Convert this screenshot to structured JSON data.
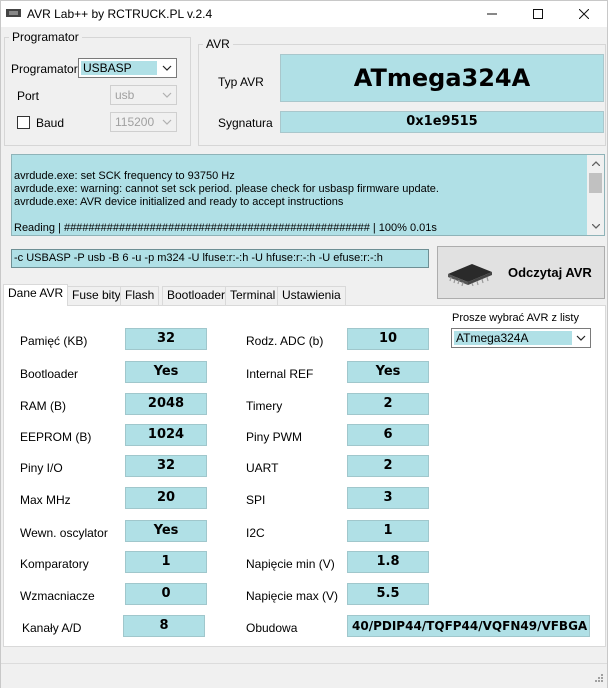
{
  "window": {
    "title": "AVR Lab++ by RCTRUCK.PL v.2.4"
  },
  "programmer": {
    "legend": "Programator",
    "programmer_label": "Programator",
    "programmer_value": "USBASP",
    "port_label": "Port",
    "port_value": "usb",
    "baud_label": "Baud",
    "baud_value": "115200",
    "baud_checked": false
  },
  "avr": {
    "legend": "AVR",
    "type_label": "Typ AVR",
    "type_value": "ATmega324A",
    "signature_label": "Sygnatura",
    "signature_value": "0x1e9515"
  },
  "log": {
    "lines": [
      "avrdude.exe: set SCK frequency to 93750 Hz",
      "avrdude.exe: warning: cannot set sck period. please check for usbasp firmware update.",
      "avrdude.exe: AVR device initialized and ready to accept instructions",
      "",
      "Reading | ################################################## | 100% 0.01s"
    ]
  },
  "command": "-c USBASP -P usb -B 6 -u  -p m324 -U lfuse:r:-:h -U hfuse:r:-:h -U efuse:r:-:h",
  "read_button": "Odczytaj AVR",
  "tabs": [
    "Dane AVR",
    "Fuse bity",
    "Flash",
    "Bootloader",
    "Terminal",
    "Ustawienia"
  ],
  "active_tab": 0,
  "select_avr": {
    "label": "Prosze wybrać AVR z listy",
    "value": "ATmega324A"
  },
  "left_params": [
    {
      "label": "Pamięć (KB)",
      "value": "32"
    },
    {
      "label": "Bootloader",
      "value": "Yes"
    },
    {
      "label": "RAM (B)",
      "value": "2048"
    },
    {
      "label": "EEPROM (B)",
      "value": "1024"
    },
    {
      "label": "Piny I/O",
      "value": "32"
    },
    {
      "label": "Max MHz",
      "value": "20"
    },
    {
      "label": "Wewn. oscylator",
      "value": "Yes"
    },
    {
      "label": "Komparatory",
      "value": "1"
    },
    {
      "label": "Wzmacniacze",
      "value": "0"
    },
    {
      "label": "Kanały A/D",
      "value": "8"
    }
  ],
  "right_params": [
    {
      "label": "Rodz. ADC (b)",
      "value": "10"
    },
    {
      "label": "Internal REF",
      "value": "Yes"
    },
    {
      "label": "Timery",
      "value": "2"
    },
    {
      "label": "Piny PWM",
      "value": "6"
    },
    {
      "label": "UART",
      "value": "2"
    },
    {
      "label": "SPI",
      "value": "3"
    },
    {
      "label": "I2C",
      "value": "1"
    },
    {
      "label": "Napięcie min (V)",
      "value": "1.8"
    },
    {
      "label": "Napięcie max (V)",
      "value": "5.5"
    }
  ],
  "package": {
    "label": "Obudowa",
    "value": "40/PDIP44/TQFP44/VQFN49/VFBGA"
  },
  "icons": [
    "app-icon",
    "minimize-icon",
    "maximize-icon",
    "close-icon",
    "chevron-down-icon",
    "chip-icon",
    "resize-grip-icon"
  ]
}
